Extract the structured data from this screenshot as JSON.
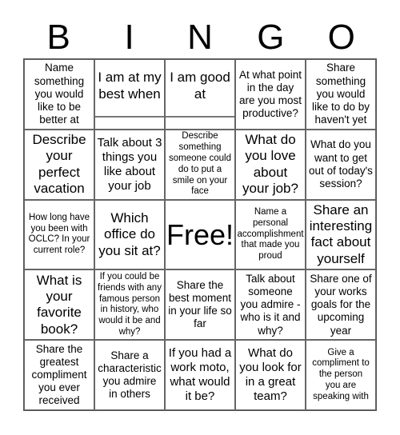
{
  "title_letters": [
    "B",
    "I",
    "N",
    "G",
    "O"
  ],
  "cells": [
    {
      "text": "Name\nsomething\nyou would\nlike to be\nbetter at",
      "size": "s-sm"
    },
    {
      "text": "I am at my\nbest when\n__________",
      "size": "s-lg"
    },
    {
      "text": "I am good\nat\n__________",
      "size": "s-lg"
    },
    {
      "text": "At what point\nin the day\nare you most\nproductive?",
      "size": "s-sm"
    },
    {
      "text": "Share\nsomething\nyou would\nlike to do by\nhaven't yet",
      "size": "s-sm"
    },
    {
      "text": "Describe\nyour\nperfect\nvacation",
      "size": "s-lg"
    },
    {
      "text": "Talk about 3\nthings you\nlike about\nyour job",
      "size": "s-md"
    },
    {
      "text": "Describe\nsomething\nsomeone could\ndo to put a\nsmile on your\nface",
      "size": "s-xs"
    },
    {
      "text": "What do\nyou love\nabout\nyour job?",
      "size": "s-lg"
    },
    {
      "text": "What do you\nwant to get\nout of today's\nsession?",
      "size": "s-sm"
    },
    {
      "text": "How long have\nyou been with\nOCLC? In your\ncurrent role?",
      "size": "s-xs"
    },
    {
      "text": "Which\noffice do\nyou sit at?",
      "size": "s-lg"
    },
    {
      "text": "Free!",
      "size": "s-xl"
    },
    {
      "text": "Name a\npersonal\naccomplishment\nthat made you\nproud",
      "size": "s-xs"
    },
    {
      "text": "Share an\ninteresting\nfact about\nyourself",
      "size": "s-lg"
    },
    {
      "text": "What is\nyour\nfavorite\nbook?",
      "size": "s-lg"
    },
    {
      "text": "If you could be\nfriends with any\nfamous person\nin history, who\nwould it be and\nwhy?",
      "size": "s-xs"
    },
    {
      "text": "Share the\nbest moment\nin your life so\nfar",
      "size": "s-sm"
    },
    {
      "text": "Talk about\nsomeone\nyou admire -\nwho is it and\nwhy?",
      "size": "s-sm"
    },
    {
      "text": "Share one of\nyour works\ngoals for the\nupcoming\nyear",
      "size": "s-sm"
    },
    {
      "text": "Share the\ngreatest\ncompliment\nyou ever\nreceived",
      "size": "s-sm"
    },
    {
      "text": "Share a\ncharacteristic\nyou admire\nin others",
      "size": "s-sm"
    },
    {
      "text": "If you had a\nwork moto,\nwhat would\nit be?",
      "size": "s-md"
    },
    {
      "text": "What do\nyou look for\nin a great\nteam?",
      "size": "s-md"
    },
    {
      "text": "Give a\ncompliment to\nthe person\nyou are\nspeaking with",
      "size": "s-xs"
    }
  ]
}
